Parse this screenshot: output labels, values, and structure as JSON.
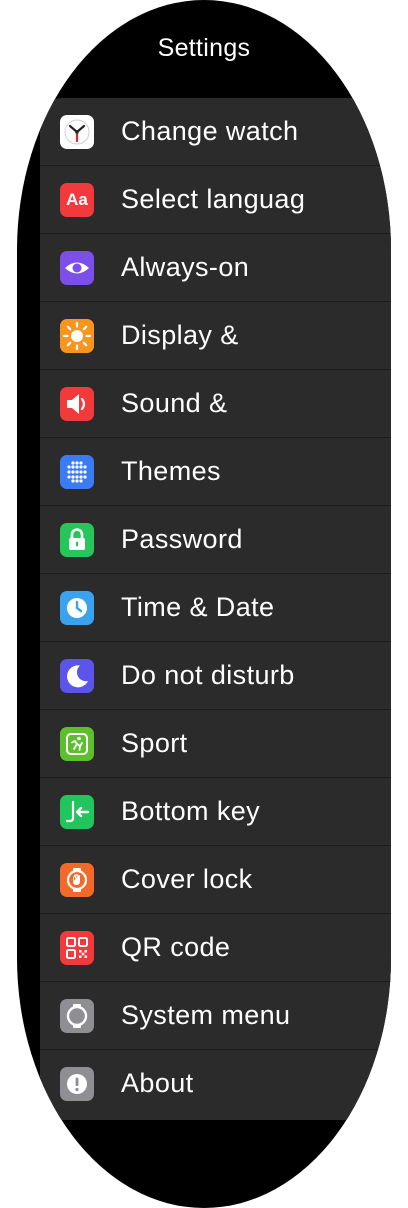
{
  "header": {
    "title": "Settings"
  },
  "items": [
    {
      "label": "Change watch",
      "icon": "watch-face-icon",
      "color": "#ffffff"
    },
    {
      "label": "Select languag",
      "icon": "language-icon",
      "color": "#f2393c",
      "glyph": "Aa"
    },
    {
      "label": "Always-on",
      "icon": "eye-icon",
      "color": "#7b4fe8"
    },
    {
      "label": "Display &",
      "icon": "sun-icon",
      "color": "#f7951e"
    },
    {
      "label": "Sound &",
      "icon": "speaker-icon",
      "color": "#f2393c"
    },
    {
      "label": "Themes",
      "icon": "themes-icon",
      "color": "#3b7cf5"
    },
    {
      "label": "Password",
      "icon": "lock-icon",
      "color": "#27c65a"
    },
    {
      "label": "Time & Date",
      "icon": "clock-icon",
      "color": "#3aa2ee"
    },
    {
      "label": "Do not disturb",
      "icon": "moon-icon",
      "color": "#5b55ea"
    },
    {
      "label": "Sport",
      "icon": "sport-icon",
      "color": "#5ebf2e"
    },
    {
      "label": "Bottom key",
      "icon": "bottom-key-icon",
      "color": "#22c45c"
    },
    {
      "label": "Cover lock",
      "icon": "cover-lock-icon",
      "color": "#f2692a"
    },
    {
      "label": "QR code",
      "icon": "qr-code-icon",
      "color": "#f2393c"
    },
    {
      "label": "System menu",
      "icon": "system-menu-icon",
      "color": "#8e8e93"
    },
    {
      "label": "About",
      "icon": "info-icon",
      "color": "#8e8e93"
    }
  ]
}
